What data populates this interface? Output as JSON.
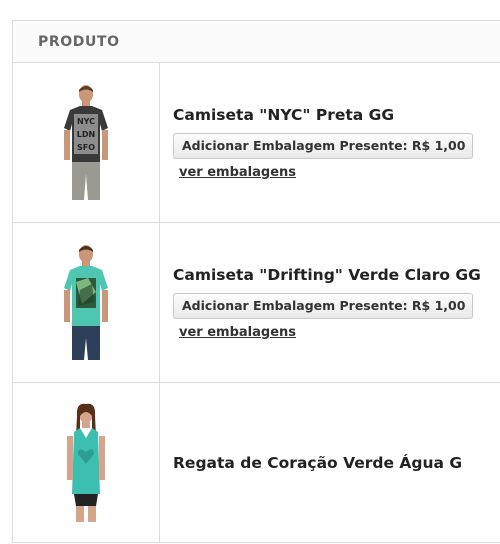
{
  "table": {
    "header": "PRODUTO"
  },
  "products": [
    {
      "name": "Camiseta \"NYC\" Preta GG",
      "gift_button": "Adicionar Embalagem Presente: R$ 1,00",
      "view_link": "ver embalagens",
      "image_icon": "tshirt-nyc-image",
      "shirt_color": "#3a3a3a",
      "shirt_print": [
        "NYC",
        "LDN",
        "SFO"
      ]
    },
    {
      "name": "Camiseta \"Drifting\" Verde Claro GG",
      "gift_button": "Adicionar Embalagem Presente: R$ 1,00",
      "view_link": "ver embalagens",
      "image_icon": "tshirt-drifting-image",
      "shirt_color": "#4fc7b0"
    },
    {
      "name": "Regata de Coração Verde Água G",
      "image_icon": "tanktop-heart-image",
      "shirt_color": "#3cbfb0"
    }
  ]
}
